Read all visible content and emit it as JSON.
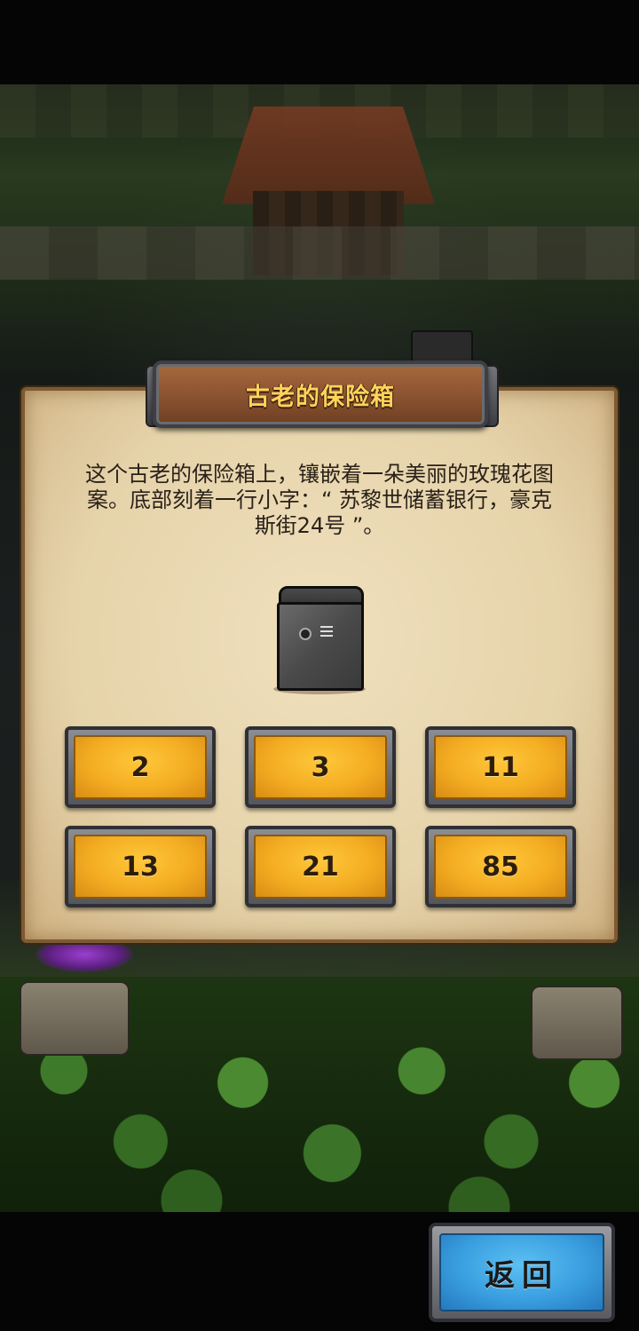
{
  "dialog": {
    "title": "古老的保险箱",
    "description": "这个古老的保险箱上，镶嵌着一朵美丽的玫瑰花图案。底部刻着一行小字：“ 苏黎世储蓄银行，豪克斯街24号 ”。",
    "item_icon": "safe-icon",
    "answers": [
      "2",
      "3",
      "11",
      "13",
      "21",
      "85"
    ]
  },
  "back_button": {
    "label": "返回"
  },
  "colors": {
    "title_text": "#ffd35a",
    "answer_button": "#f4ad22",
    "back_button": "#3a9fe0",
    "parchment": "#e6d3aa"
  }
}
